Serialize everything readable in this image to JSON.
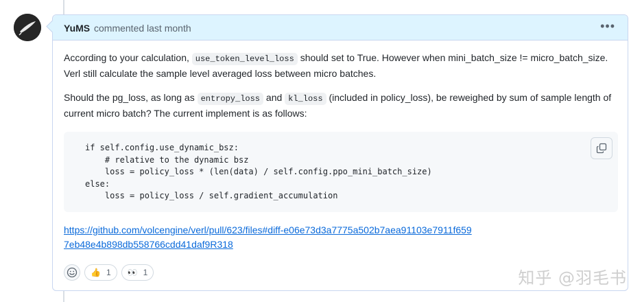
{
  "comment": {
    "author": "YuMS",
    "meta": "commented last month",
    "menu_icon": "kebab-horizontal-icon",
    "p1": {
      "t1": "According to your calculation,",
      "c1": "use_token_level_loss",
      "t2": "should set to True. However when mini_batch_size != micro_batch_size. Verl still calculate the sample level averaged loss between micro batches."
    },
    "p2": {
      "t1": "Should the pg_loss, as long as",
      "c1": "entropy_loss",
      "t2": "and",
      "c2": "kl_loss",
      "t3": "(included in policy_loss), be reweighed by sum of sample length of current micro batch? The current implement is as follows:"
    },
    "code": "if self.config.use_dynamic_bsz:\n    # relative to the dynamic bsz\n    loss = policy_loss * (len(data) / self.config.ppo_mini_batch_size)\nelse:\n    loss = policy_loss / self.gradient_accumulation",
    "link": "https://github.com/volcengine/verl/pull/623/files#diff-e06e73d3a7775a502b7aea91103e7911f6597eb48e4b898db558766cdd41daf9R318",
    "reactions": [
      {
        "emoji": "👍",
        "icon": "thumbs-up-icon",
        "count": "1"
      },
      {
        "emoji": "👀",
        "icon": "eyes-icon",
        "count": "1"
      }
    ]
  },
  "watermark": "知乎 @羽毛书",
  "colors": {
    "header_bg": "#ddf4ff",
    "link": "#0969da",
    "code_bg": "#f6f8fa"
  }
}
